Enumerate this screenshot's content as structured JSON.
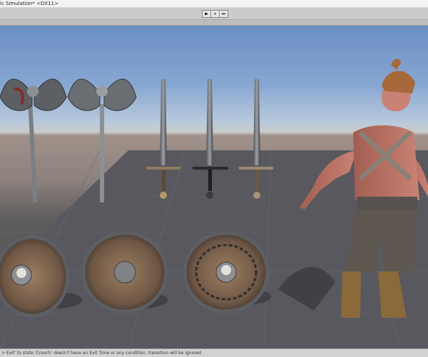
{
  "window": {
    "title": "ic Simulation* <DX11>"
  },
  "toolbar": {
    "play_icon": "▶",
    "pause_icon": "⏸",
    "step_icon": "⏭"
  },
  "scene": {
    "objects": [
      "double-axe-bloody",
      "double-axe",
      "longsword-bronze",
      "longsword-dark",
      "longsword-steel",
      "round-shield-skull",
      "round-shield-boss",
      "round-shield-chain-skull",
      "gladiator-character"
    ]
  },
  "status": {
    "message": "> Exit' to state 'Crouch' doesn't have an Exit Time or any condition, transition will be ignored"
  },
  "colors": {
    "sky_top": "#6c8fc3",
    "ground": "#4a4a4f",
    "toolbar": "#cbcbcb"
  }
}
